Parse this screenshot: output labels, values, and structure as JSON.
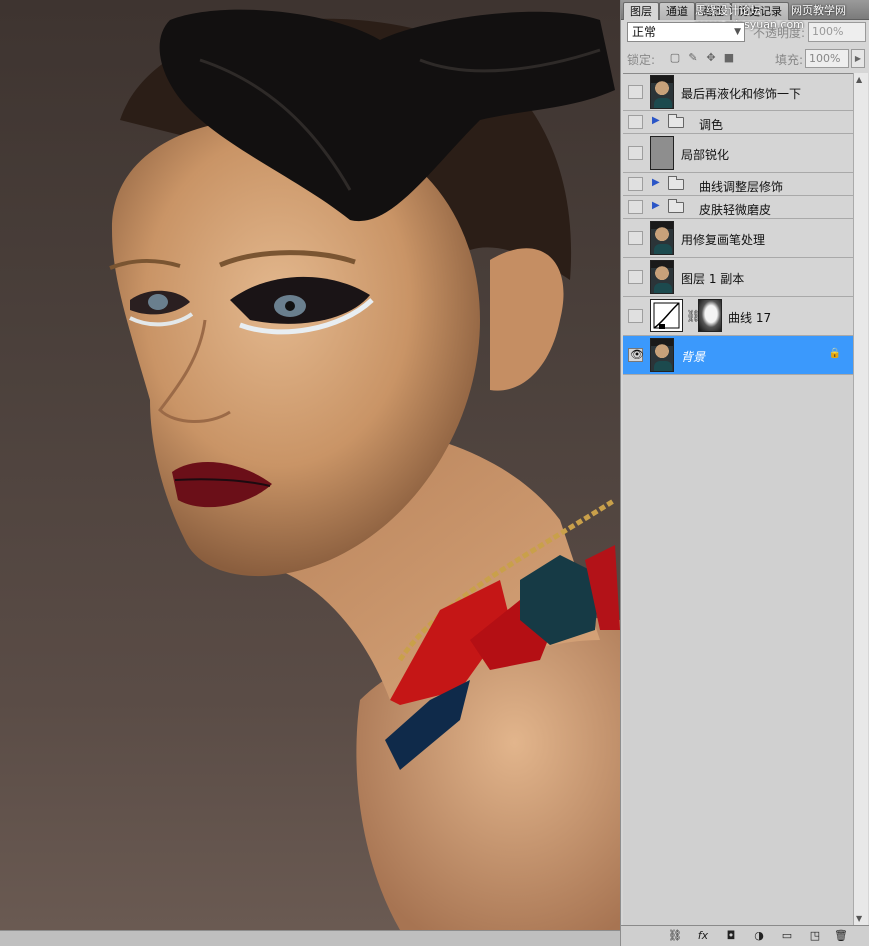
{
  "panel": {
    "tabs": [
      "图层",
      "通道",
      "路径",
      "历史记录"
    ],
    "watermark": "思缘设计论坛 www.missyuan.com",
    "watermark2": "网页教学网",
    "blend_mode": "正常",
    "opacity_label": "不透明度:",
    "opacity_value": "100%",
    "lock_label": "锁定:",
    "fill_label": "填充:",
    "fill_value": "100%"
  },
  "layers": [
    {
      "name": "最后再液化和修饰一下",
      "kind": "photo",
      "visible": false
    },
    {
      "name": "调色",
      "kind": "group",
      "visible": false
    },
    {
      "name": "局部锐化",
      "kind": "grey",
      "visible": false
    },
    {
      "name": "曲线调整层修饰",
      "kind": "group",
      "visible": false
    },
    {
      "name": "皮肤轻微磨皮",
      "kind": "group",
      "visible": false
    },
    {
      "name": "用修复画笔处理",
      "kind": "photo",
      "visible": false
    },
    {
      "name": "图层 1 副本",
      "kind": "photo",
      "visible": false
    },
    {
      "name": "曲线 17",
      "kind": "adjustment",
      "visible": false
    },
    {
      "name": "背景",
      "kind": "photo",
      "visible": true,
      "selected": true,
      "locked": true
    }
  ],
  "icons": {
    "eye": "eye-icon",
    "bottom_bar": [
      "link-icon",
      "fx-icon",
      "mask-icon",
      "adjustment-icon",
      "group-folder-icon",
      "new-layer-icon",
      "trash-icon"
    ]
  },
  "colors": {
    "selection": "#3b99fc",
    "panel_bg": "#d6d6d6"
  }
}
